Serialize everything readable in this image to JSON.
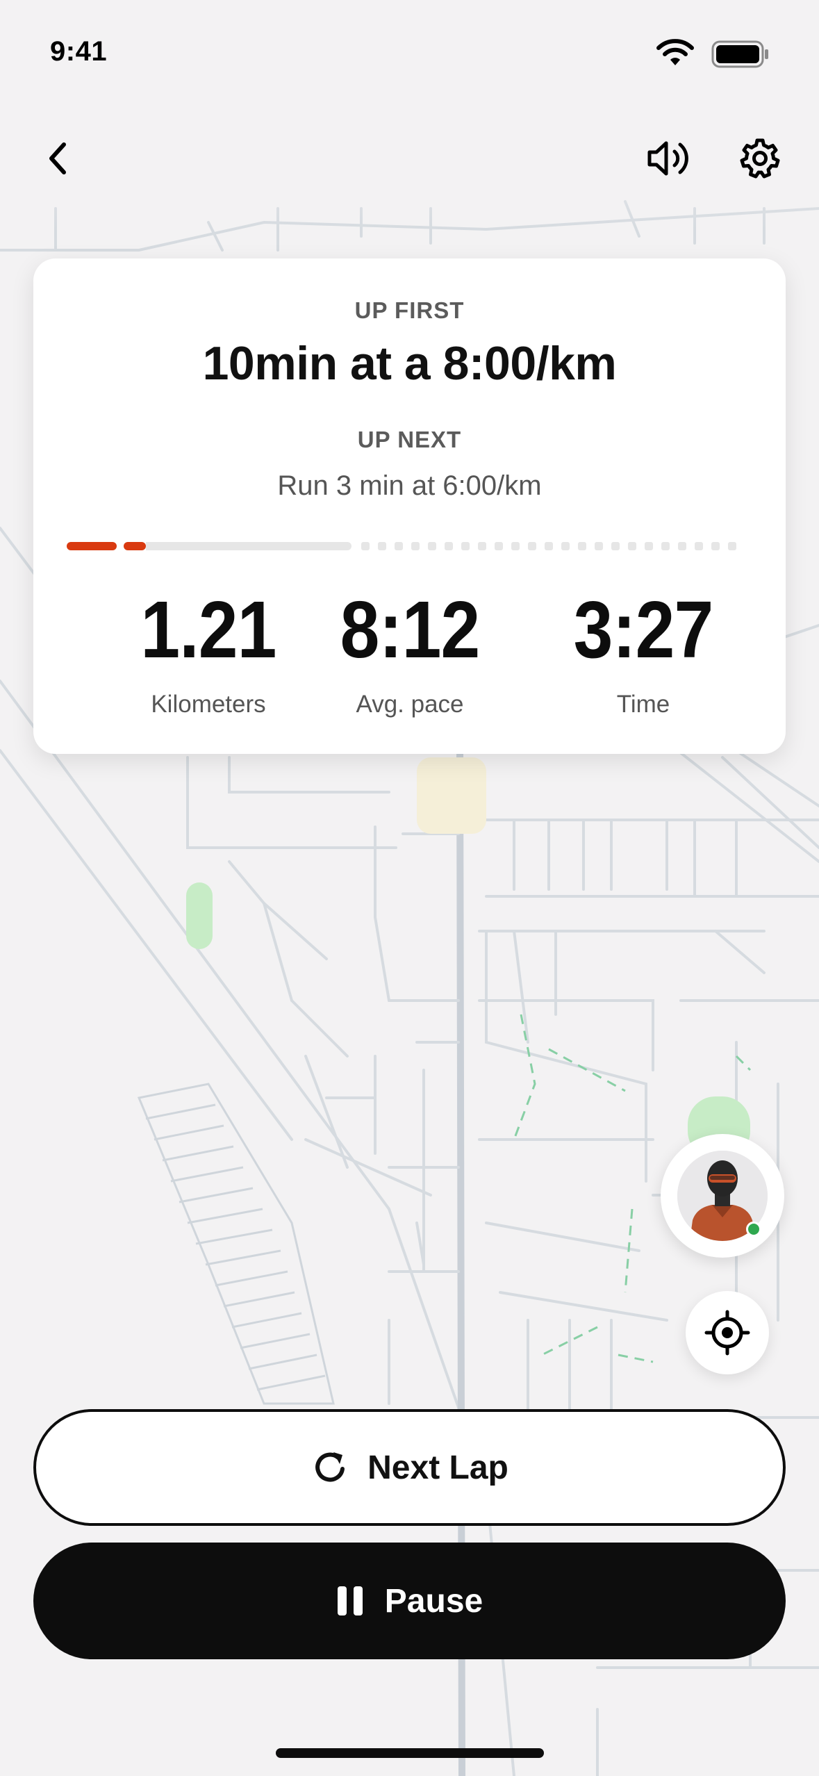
{
  "status_bar": {
    "time": "9:41",
    "icons": [
      "wifi-icon",
      "battery-icon"
    ]
  },
  "nav": {
    "back_icon": "chevron-left-icon",
    "sound_icon": "speaker-icon",
    "settings_icon": "gear-icon"
  },
  "workout": {
    "up_first_label": "UP FIRST",
    "up_first_value": "10min at a 8:00/km",
    "up_next_label": "UP NEXT",
    "up_next_value": "Run 3 min at 6:00/km",
    "progress": {
      "accent_color": "#d93a10",
      "track_color": "#e6e6e6"
    },
    "stats": [
      {
        "value": "1.21",
        "label": "Kilometers"
      },
      {
        "value": "8:12",
        "label": "Avg. pace"
      },
      {
        "value": "3:27",
        "label": "Time"
      }
    ]
  },
  "coach": {
    "icon": "coach-avatar",
    "status_color": "#2fa84f"
  },
  "actions": {
    "next_lap_label": "Next Lap",
    "next_lap_icon": "refresh-icon",
    "pause_label": "Pause",
    "pause_icon": "pause-icon",
    "locate_icon": "crosshair-icon"
  }
}
